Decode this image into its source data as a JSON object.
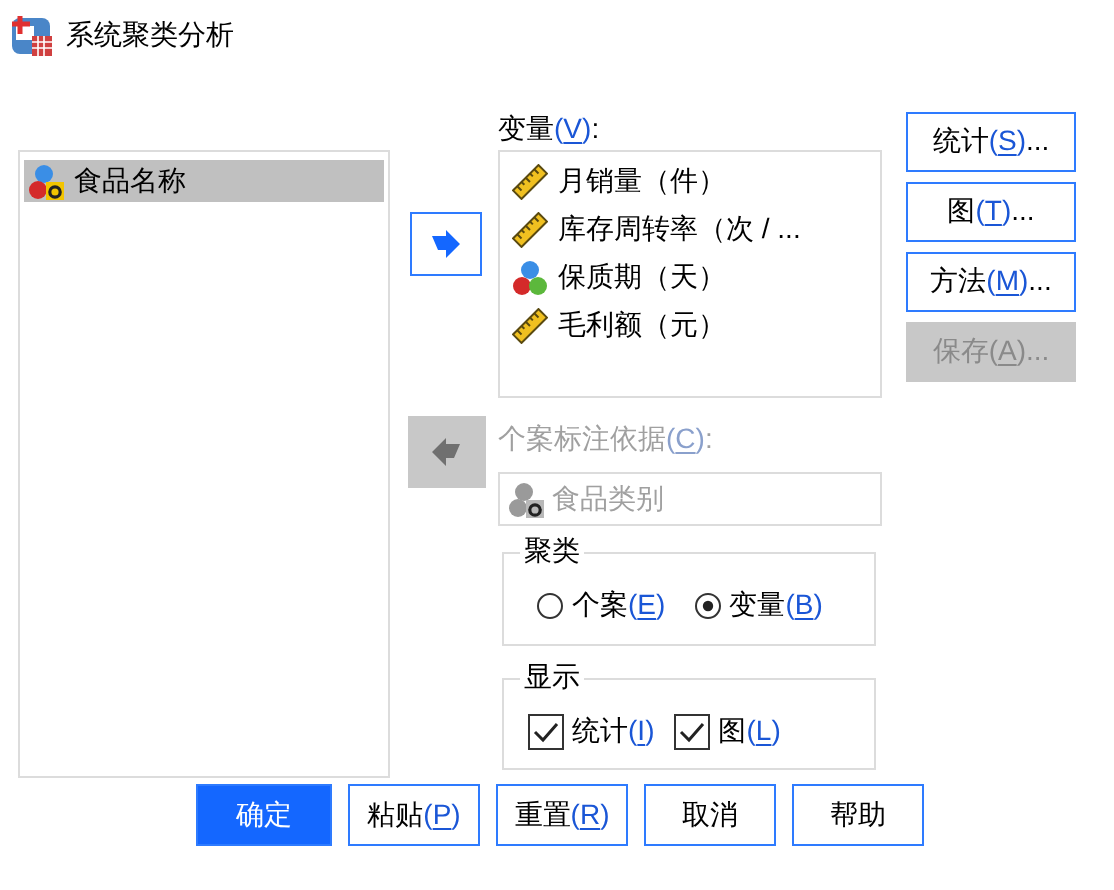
{
  "window": {
    "title": "系统聚类分析"
  },
  "source_list": {
    "items": [
      {
        "label": "食品名称",
        "kind": "string",
        "selected": true
      }
    ]
  },
  "move_buttons": [
    {
      "kind": "right",
      "disabled": false
    },
    {
      "kind": "left",
      "disabled": true
    }
  ],
  "variables": {
    "label": "变量(V):",
    "items": [
      {
        "label": "月销量（件）",
        "kind": "scale"
      },
      {
        "label": "库存周转率（次 / ...",
        "kind": "scale"
      },
      {
        "label": "保质期（天）",
        "kind": "nominal"
      },
      {
        "label": "毛利额（元）",
        "kind": "scale"
      }
    ]
  },
  "label_cases": {
    "label": "个案标注依据(C):",
    "disabled": true,
    "value": "食品类别",
    "kind": "string"
  },
  "cluster": {
    "title": "聚类",
    "options": [
      {
        "label": "个案(E)",
        "selected": false
      },
      {
        "label": "变量(B)",
        "selected": true
      }
    ]
  },
  "display": {
    "title": "显示",
    "options": [
      {
        "label": "统计(I)",
        "checked": true
      },
      {
        "label": "图(L)",
        "checked": true
      }
    ]
  },
  "side_buttons": [
    {
      "label": "统计(S)...",
      "disabled": false
    },
    {
      "label": "图(T)...",
      "disabled": false
    },
    {
      "label": "方法(M)...",
      "disabled": false
    },
    {
      "label": "保存(A)...",
      "disabled": true
    }
  ],
  "footer_buttons": [
    {
      "label": "确定",
      "primary": true
    },
    {
      "label": "粘贴(P)",
      "primary": false
    },
    {
      "label": "重置(R)",
      "primary": false
    },
    {
      "label": "取消",
      "primary": false
    },
    {
      "label": "帮助",
      "primary": false
    }
  ]
}
